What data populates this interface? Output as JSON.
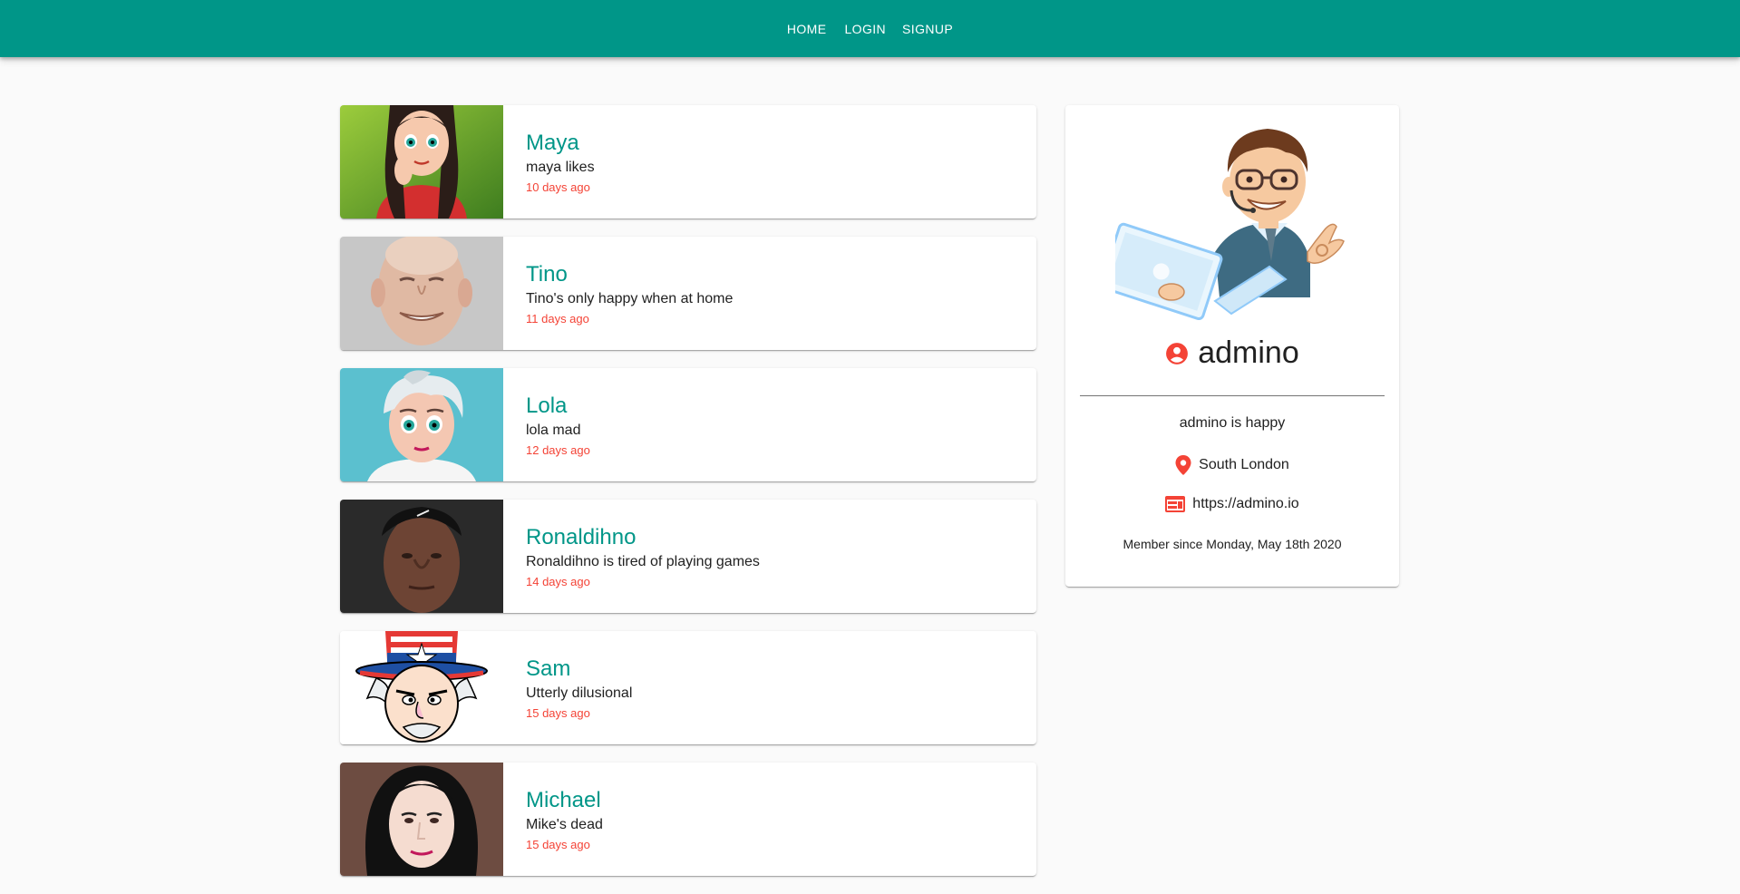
{
  "nav": {
    "home": "HOME",
    "login": "LOGIN",
    "signup": "SIGNUP"
  },
  "posts": [
    {
      "name": "Maya",
      "text": "maya likes",
      "time": "10 days ago"
    },
    {
      "name": "Tino",
      "text": "Tino's only happy when at home",
      "time": "11 days ago"
    },
    {
      "name": "Lola",
      "text": "lola mad",
      "time": "12 days ago"
    },
    {
      "name": "Ronaldihno",
      "text": "Ronaldihno is tired of playing games",
      "time": "14 days ago"
    },
    {
      "name": "Sam",
      "text": "Utterly dilusional",
      "time": "15 days ago"
    },
    {
      "name": "Michael",
      "text": "Mike's dead",
      "time": "15 days ago"
    }
  ],
  "profile": {
    "handle": "admino",
    "bio": "admino is happy",
    "location": "South London",
    "website": "https://admino.io",
    "member_since": "Member since Monday, May 18th 2020",
    "icons": [
      "account-circle-icon",
      "location-pin-icon",
      "web-icon"
    ]
  },
  "colors": {
    "primary": "#009688",
    "secondary": "#f44336",
    "background": "#fafafa"
  }
}
